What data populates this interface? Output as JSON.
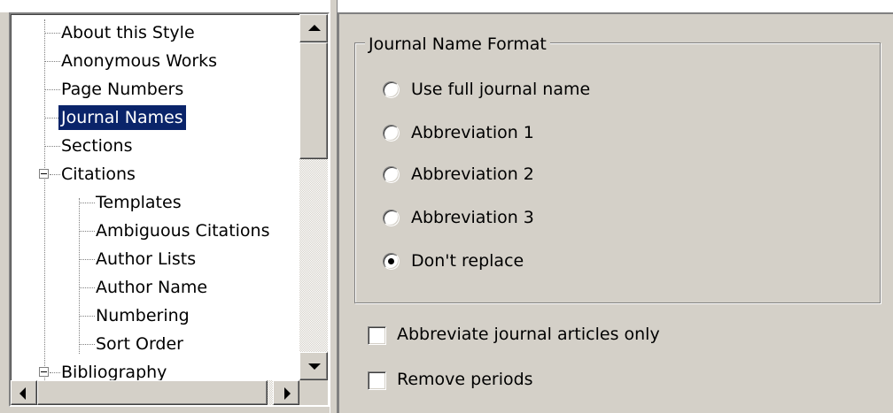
{
  "tree": {
    "items": [
      {
        "label": "About this Style"
      },
      {
        "label": "Anonymous Works"
      },
      {
        "label": "Page Numbers"
      },
      {
        "label": "Journal Names",
        "selected": true
      },
      {
        "label": "Sections"
      },
      {
        "label": "Citations",
        "expanded": true
      },
      {
        "label": "Templates"
      },
      {
        "label": "Ambiguous Citations"
      },
      {
        "label": "Author Lists"
      },
      {
        "label": "Author Name"
      },
      {
        "label": "Numbering"
      },
      {
        "label": "Sort Order"
      },
      {
        "label": "Bibliography",
        "expanded": true
      }
    ]
  },
  "journal_name_format": {
    "legend": "Journal Name Format",
    "options": [
      {
        "label": "Use full journal name",
        "checked": false
      },
      {
        "label": "Abbreviation 1",
        "checked": false
      },
      {
        "label": "Abbreviation 2",
        "checked": false
      },
      {
        "label": "Abbreviation 3",
        "checked": false
      },
      {
        "label": "Don't replace",
        "checked": true
      }
    ]
  },
  "checkboxes": [
    {
      "label": "Abbreviate journal articles only",
      "checked": false
    },
    {
      "label": "Remove periods",
      "checked": false
    }
  ],
  "colors": {
    "selection": "#0a246a",
    "face": "#d4d0c8"
  }
}
